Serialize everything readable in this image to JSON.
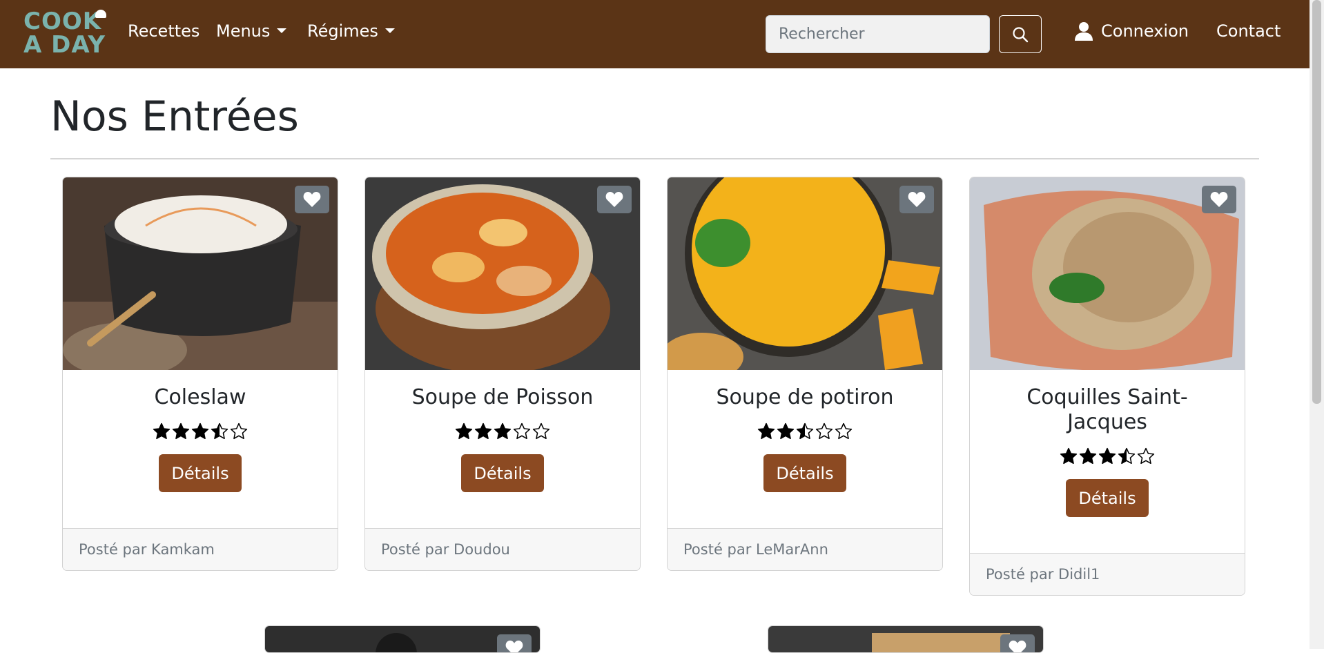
{
  "navbar": {
    "logo_line1": "COOK",
    "logo_line2": "A DAY",
    "links": {
      "recettes": "Recettes",
      "menus": "Menus",
      "regimes": "Régimes",
      "contact": "Contact"
    },
    "search_placeholder": "Rechercher",
    "login": "Connexion"
  },
  "page": {
    "title": "Nos Entrées"
  },
  "cards": [
    {
      "title": "Coleslaw",
      "rating": 3.5,
      "button": "Détails",
      "footer": "Posté par Kamkam"
    },
    {
      "title": "Soupe de Poisson",
      "rating": 3,
      "button": "Détails",
      "footer": "Posté par Doudou"
    },
    {
      "title": "Soupe de potiron",
      "rating": 2.5,
      "button": "Détails",
      "footer": "Posté par LeMarAnn"
    },
    {
      "title": "Coquilles Saint-Jacques",
      "rating": 3.5,
      "button": "Détails",
      "footer": "Posté par Didil1"
    }
  ],
  "colors": {
    "navbar": "#5b3416",
    "button": "#8c4a22",
    "logo": "#7ab3ad"
  },
  "icons": {
    "search": "search-icon",
    "user": "user-icon",
    "heart": "heart-icon",
    "star": "star-icon"
  }
}
